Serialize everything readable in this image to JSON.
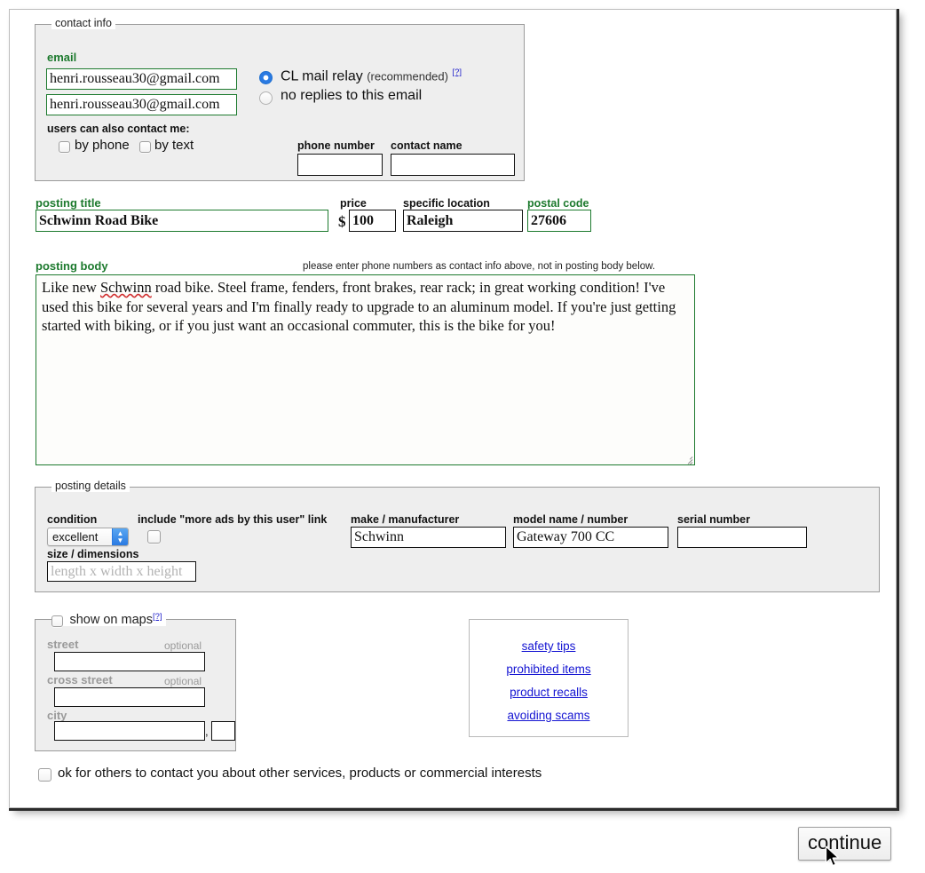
{
  "contact_info": {
    "legend": "contact info",
    "email_label": "email",
    "email_value": "henri.rousseau30@gmail.com",
    "email_confirm_value": "henri.rousseau30@gmail.com",
    "email_placeholder": "",
    "radio_relay_label": "CL mail relay",
    "radio_relay_sub": "(recommended)",
    "radio_relay_help": "[?]",
    "radio_relay_selected": true,
    "radio_noreply_label": "no replies to this email",
    "radio_noreply_selected": false,
    "also_contact_label": "users can also contact me:",
    "by_phone_label": "by phone",
    "by_phone_checked": false,
    "by_text_label": "by text",
    "by_text_checked": false,
    "phone_number_label": "phone number",
    "phone_number_value": "",
    "contact_name_label": "contact name",
    "contact_name_value": ""
  },
  "posting": {
    "title_label": "posting title",
    "title_value": "Schwinn Road Bike",
    "price_label": "price",
    "price_currency": "$",
    "price_value": "100",
    "specific_location_label": "specific location",
    "specific_location_value": "Raleigh",
    "postal_code_label": "postal code",
    "postal_code_value": "27606",
    "body_label": "posting body",
    "body_note": "please enter phone numbers as contact info above, not in posting body below.",
    "body_value": "Like new Schwinn road bike. Steel frame, fenders, front brakes, rear rack; in great working condition! I've used this bike for several years and I'm finally ready to upgrade to an aluminum model. If you're just getting started with biking, or if you just want an occasional commuter, this is the bike for you!",
    "body_misspelled_word": "Schwinn",
    "body_before_misspelled": "Like new ",
    "body_after_misspelled": " road bike. Steel frame, fenders, front brakes, rear rack; in great working condition! I've used this bike for several years and I'm finally ready to upgrade to an aluminum model. If you're just getting started with biking, or if you just want an occasional commuter, this is the bike for you!"
  },
  "posting_details": {
    "legend": "posting details",
    "condition_label": "condition",
    "condition_value": "excellent",
    "more_ads_label": "include \"more ads by this user\" link",
    "more_ads_checked": false,
    "make_label": "make / manufacturer",
    "make_value": "Schwinn",
    "model_label": "model name / number",
    "model_value": "Gateway 700 CC",
    "serial_label": "serial number",
    "serial_value": "",
    "size_label": "size / dimensions",
    "size_value": "",
    "size_placeholder": "length x width x height"
  },
  "maps": {
    "legend_label": "show on maps",
    "legend_help": "[?]",
    "legend_checked": false,
    "street_label": "street",
    "street_optional": "optional",
    "street_value": "",
    "cross_street_label": "cross street",
    "cross_street_optional": "optional",
    "cross_street_value": "",
    "city_label": "city",
    "city_value": "",
    "city_state_separator": ",",
    "state_value": ""
  },
  "links_panel": {
    "items": [
      {
        "label": "safety tips"
      },
      {
        "label": "prohibited items"
      },
      {
        "label": "product recalls"
      },
      {
        "label": "avoiding scams"
      }
    ]
  },
  "footer": {
    "ok_contact_label": "ok for others to contact you about other services, products or commercial interests",
    "ok_contact_checked": false,
    "continue_label": "continue"
  },
  "colors": {
    "green_label": "#1d7a2e",
    "link_blue": "#1414d2",
    "radio_blue": "#2a7ae2",
    "fieldset_bg": "#eeeeee",
    "spellcheck_red": "#d03030"
  }
}
